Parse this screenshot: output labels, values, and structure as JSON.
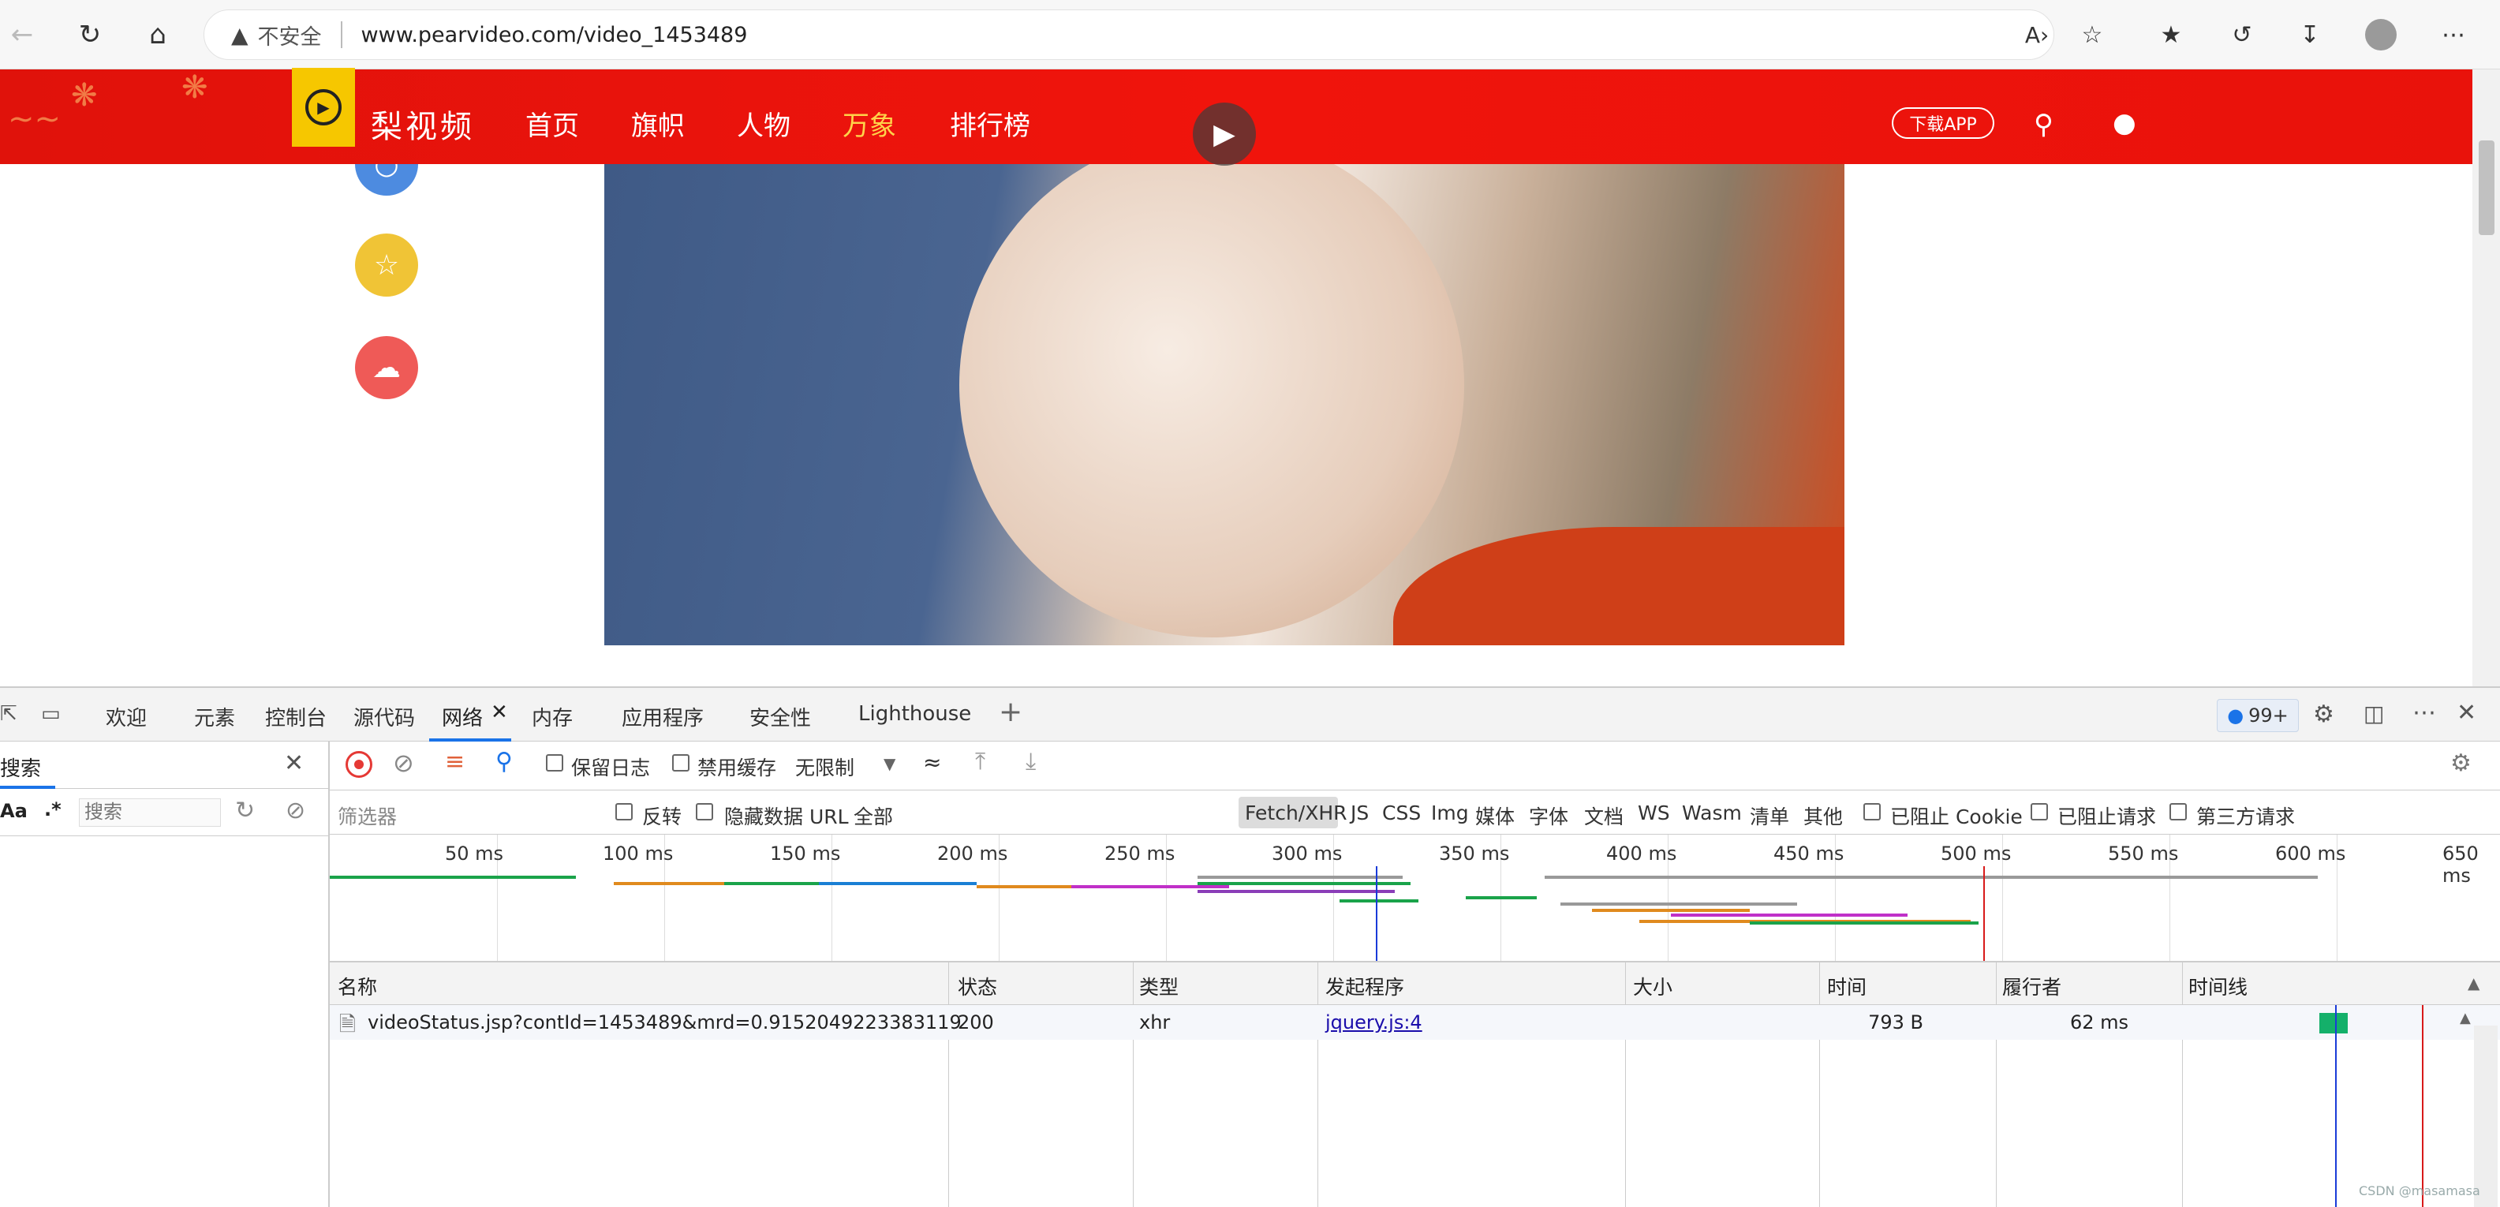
{
  "browser": {
    "security": "不安全",
    "url": "www.pearvideo.com/video_1453489",
    "icons": [
      "back-icon",
      "refresh-icon",
      "home-icon",
      "read-aloud-icon",
      "add-favorite-icon",
      "favorites-icon",
      "history-icon",
      "download-icon",
      "profile-icon",
      "more-icon"
    ]
  },
  "site": {
    "brand": "梨视频",
    "nav": [
      "首页",
      "旗帜",
      "人物",
      "万象",
      "排行榜"
    ],
    "active_nav": "万象",
    "download_app": "下载APP",
    "colors": {
      "header": "#e8130b",
      "logo": "#f6c700",
      "active_nav": "#ffd34a"
    }
  },
  "devtools": {
    "tabs": [
      "欢迎",
      "元素",
      "控制台",
      "源代码",
      "网络",
      "内存",
      "应用程序",
      "安全性",
      "Lighthouse"
    ],
    "active_tab": "网络",
    "badge": "99+",
    "search": {
      "tab_label": "搜索",
      "case_label": "Aa",
      "regex_label": ".*",
      "placeholder": "搜索"
    },
    "toolbar": {
      "preserve_log": "保留日志",
      "disable_cache": "禁用缓存",
      "throttle": "无限制"
    },
    "filter": {
      "placeholder": "筛选器",
      "invert": "反转",
      "hide_data_url": "隐藏数据 URL",
      "types": [
        "全部",
        "Fetch/XHR",
        "JS",
        "CSS",
        "Img",
        "媒体",
        "字体",
        "文档",
        "WS",
        "Wasm",
        "清单",
        "其他"
      ],
      "blocked_cookies": "已阻止 Cookie",
      "blocked_requests": "已阻止请求",
      "third_party": "第三方请求"
    },
    "timeline_ticks": [
      "50 ms",
      "100 ms",
      "150 ms",
      "200 ms",
      "250 ms",
      "300 ms",
      "350 ms",
      "400 ms",
      "450 ms",
      "500 ms",
      "550 ms",
      "600 ms",
      "650 ms"
    ],
    "columns": [
      "名称",
      "状态",
      "类型",
      "发起程序",
      "大小",
      "时间",
      "履行者",
      "时间线"
    ],
    "rows": [
      {
        "name": "videoStatus.jsp?contId=1453489&mrd=0.9152049223383119",
        "status": "200",
        "type": "xhr",
        "initiator": "jquery.js:4",
        "size": "793 B",
        "time": "62 ms",
        "fulfilled_by": ""
      }
    ]
  },
  "watermark": "CSDN @masamasa"
}
